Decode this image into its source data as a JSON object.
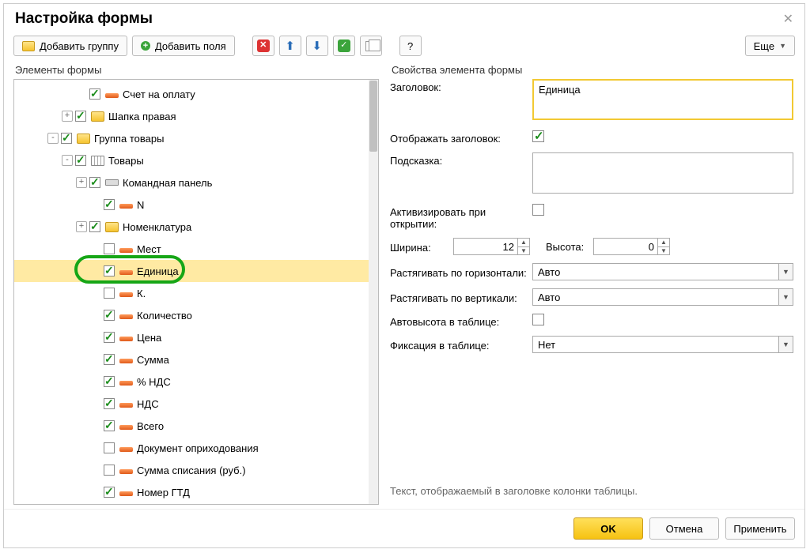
{
  "title": "Настройка формы",
  "toolbar": {
    "add_group": "Добавить группу",
    "add_fields": "Добавить поля",
    "more": "Eще"
  },
  "left_section": "Элементы формы",
  "right_section": "Свойства элемента формы",
  "tree": [
    {
      "indent": 4,
      "exp": "",
      "checked": true,
      "icon": "field",
      "label": "Счет на оплату"
    },
    {
      "indent": 3,
      "exp": "+",
      "checked": true,
      "icon": "folder",
      "label": "Шапка правая"
    },
    {
      "indent": 2,
      "exp": "-",
      "checked": true,
      "icon": "folder",
      "label": "Группа товары"
    },
    {
      "indent": 3,
      "exp": "-",
      "checked": true,
      "icon": "table",
      "label": "Товары"
    },
    {
      "indent": 4,
      "exp": "+",
      "checked": true,
      "icon": "panel",
      "label": "Командная панель"
    },
    {
      "indent": 5,
      "exp": "",
      "checked": true,
      "icon": "field",
      "label": "N"
    },
    {
      "indent": 4,
      "exp": "+",
      "checked": true,
      "icon": "folder",
      "label": "Номенклатура"
    },
    {
      "indent": 5,
      "exp": "",
      "checked": false,
      "icon": "field",
      "label": "Мест"
    },
    {
      "indent": 5,
      "exp": "",
      "checked": true,
      "icon": "field",
      "label": "Единица",
      "selected": true,
      "circle": true
    },
    {
      "indent": 5,
      "exp": "",
      "checked": false,
      "icon": "field",
      "label": "К."
    },
    {
      "indent": 5,
      "exp": "",
      "checked": true,
      "icon": "field",
      "label": "Количество"
    },
    {
      "indent": 5,
      "exp": "",
      "checked": true,
      "icon": "field",
      "label": "Цена"
    },
    {
      "indent": 5,
      "exp": "",
      "checked": true,
      "icon": "field",
      "label": "Сумма"
    },
    {
      "indent": 5,
      "exp": "",
      "checked": true,
      "icon": "field",
      "label": "% НДС"
    },
    {
      "indent": 5,
      "exp": "",
      "checked": true,
      "icon": "field",
      "label": "НДС"
    },
    {
      "indent": 5,
      "exp": "",
      "checked": true,
      "icon": "field",
      "label": "Всего"
    },
    {
      "indent": 5,
      "exp": "",
      "checked": false,
      "icon": "field",
      "label": "Документ оприходования"
    },
    {
      "indent": 5,
      "exp": "",
      "checked": false,
      "icon": "field",
      "label": "Сумма списания (руб.)"
    },
    {
      "indent": 5,
      "exp": "",
      "checked": true,
      "icon": "field",
      "label": "Номер ГТД"
    }
  ],
  "props": {
    "title_label": "Заголовок:",
    "title_value": "Единица",
    "show_title_label": "Отображать заголовок:",
    "show_title_checked": true,
    "hint_label": "Подсказка:",
    "hint_value": "",
    "activate_label": "Активизировать при открытии:",
    "width_label": "Ширина:",
    "width_value": "12",
    "height_label": "Высота:",
    "height_value": "0",
    "stretch_h_label": "Растягивать по горизонтали:",
    "stretch_h_value": "Авто",
    "stretch_v_label": "Растягивать по вертикали:",
    "stretch_v_value": "Авто",
    "autoheight_label": "Автовысота в таблице:",
    "fixation_label": "Фиксация в таблице:",
    "fixation_value": "Нет",
    "hint_text": "Текст, отображаемый в заголовке колонки таблицы."
  },
  "footer": {
    "ok": "OK",
    "cancel": "Отмена",
    "apply": "Применить"
  }
}
